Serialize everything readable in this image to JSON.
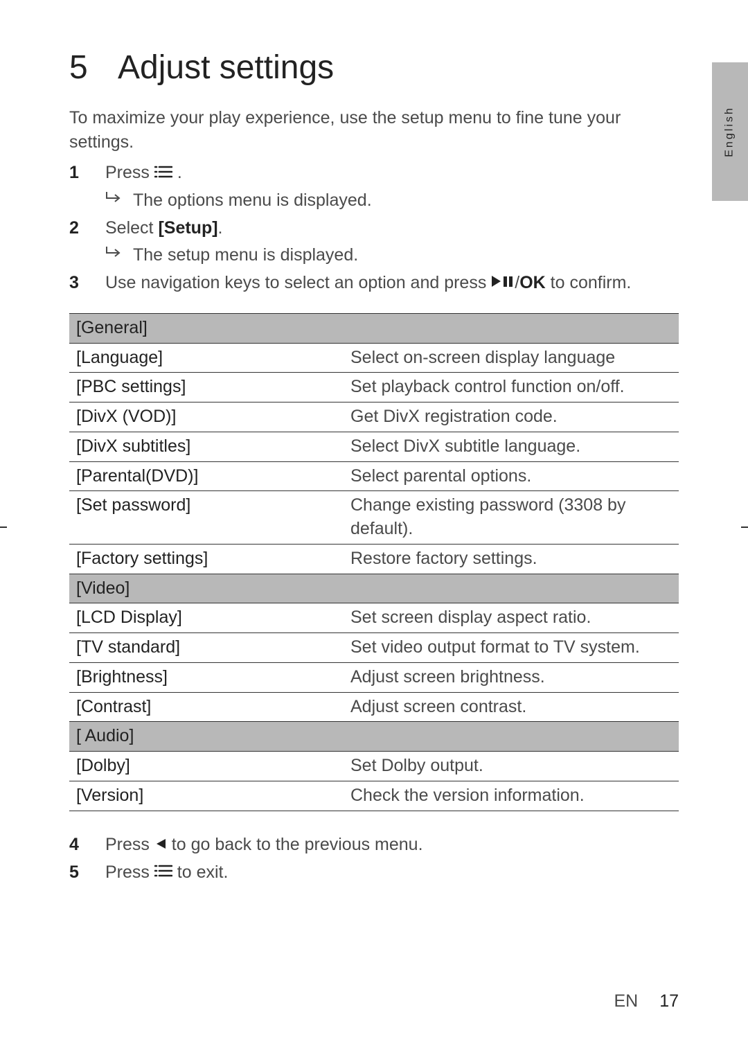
{
  "language_tab": "English",
  "section": {
    "number": "5",
    "title": "Adjust settings"
  },
  "intro": "To maximize your play experience, use the setup menu to fine tune your settings.",
  "steps": {
    "s1": {
      "num": "1",
      "text_before": "Press ",
      "text_after": " .",
      "sub": "The options menu is displayed."
    },
    "s2": {
      "num": "2",
      "text_before": "Select ",
      "bold": "[Setup]",
      "text_after": ".",
      "sub": "The setup menu is displayed."
    },
    "s3": {
      "num": "3",
      "text_before": "Use navigation keys to select an option and press ",
      "text_after": "/",
      "ok": "OK",
      "tail": " to confirm."
    },
    "s4": {
      "num": "4",
      "text_before": "Press ",
      "text_after": " to go back to the previous menu."
    },
    "s5": {
      "num": "5",
      "text_before": "Press ",
      "text_after": " to exit."
    }
  },
  "table": {
    "sections": [
      {
        "header": "[General]",
        "rows": [
          {
            "label": "[Language]",
            "desc": "Select on-screen display language"
          },
          {
            "label": "[PBC settings]",
            "desc": "Set playback control function on/off."
          },
          {
            "label": "[DivX (VOD)]",
            "desc": "Get DivX registration code."
          },
          {
            "label": "[DivX subtitles]",
            "desc": "Select DivX subtitle language."
          },
          {
            "label": "[Parental(DVD)]",
            "desc": "Select parental options."
          },
          {
            "label": "[Set password]",
            "desc": "Change existing password (3308 by default)."
          },
          {
            "label": "[Factory settings]",
            "desc": "Restore factory settings."
          }
        ]
      },
      {
        "header": "[Video]",
        "rows": [
          {
            "label": "[LCD Display]",
            "desc": "Set screen display aspect ratio."
          },
          {
            "label": "[TV standard]",
            "desc": "Set video output format to TV system."
          },
          {
            "label": "[Brightness]",
            "desc": "Adjust screen brightness."
          },
          {
            "label": "[Contrast]",
            "desc": "Adjust screen contrast."
          }
        ]
      },
      {
        "header": "[ Audio]",
        "rows": [
          {
            "label": "[Dolby]",
            "desc": "Set Dolby output."
          },
          {
            "label": "[Version]",
            "desc": "Check the version information."
          }
        ]
      }
    ]
  },
  "footer": {
    "lang": "EN",
    "page": "17"
  }
}
